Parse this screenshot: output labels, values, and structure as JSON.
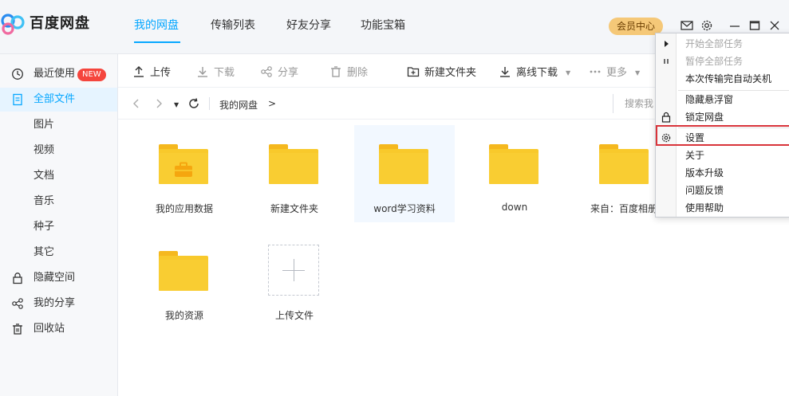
{
  "app": {
    "brand": "百度网盘"
  },
  "nav": {
    "tabs": [
      {
        "label": "我的网盘"
      },
      {
        "label": "传输列表"
      },
      {
        "label": "好友分享"
      },
      {
        "label": "功能宝箱"
      }
    ],
    "vip_label": "会员中心"
  },
  "sidebar": {
    "items": [
      {
        "label": "最近使用",
        "icon": "clock-icon",
        "badge": "NEW"
      },
      {
        "label": "全部文件",
        "icon": "document-icon"
      },
      {
        "label": "图片"
      },
      {
        "label": "视频"
      },
      {
        "label": "文档"
      },
      {
        "label": "音乐"
      },
      {
        "label": "种子"
      },
      {
        "label": "其它"
      },
      {
        "label": "隐藏空间",
        "icon": "lock-icon"
      },
      {
        "label": "我的分享",
        "icon": "share-icon"
      },
      {
        "label": "回收站",
        "icon": "trash-icon"
      }
    ]
  },
  "toolbar": {
    "upload": "上传",
    "download": "下载",
    "share": "分享",
    "delete": "删除",
    "new_folder": "新建文件夹",
    "offline_download": "离线下载",
    "more": "更多"
  },
  "path": {
    "root": "我的网盘",
    "separator": ">",
    "search_placeholder": "搜索我"
  },
  "files": [
    {
      "name": "我的应用数据"
    },
    {
      "name": "新建文件夹"
    },
    {
      "name": "word学习资料"
    },
    {
      "name": "down"
    },
    {
      "name": "来自：百度相册"
    },
    {
      "name": "我的资源"
    },
    {
      "name": "上传文件"
    }
  ],
  "menu": {
    "start_all": "开始全部任务",
    "pause_all": "暂停全部任务",
    "auto_shutdown": "本次传输完自动关机",
    "hide_float": "隐藏悬浮窗",
    "lock_disk": "锁定网盘",
    "settings": "设置",
    "about": "关于",
    "upgrade": "版本升级",
    "feedback": "问题反馈",
    "help": "使用帮助"
  },
  "colors": {
    "accent": "#06a7ff",
    "folder": "#f8c92b",
    "badge": "#f5453d",
    "vip": "#f5c878",
    "highlight": "#d9343a"
  }
}
